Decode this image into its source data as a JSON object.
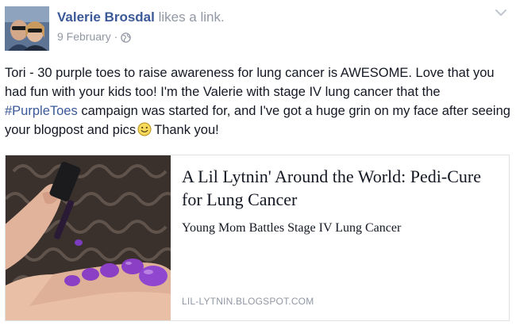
{
  "post": {
    "author": "Valerie Brosdal",
    "action": "likes a link.",
    "date": "9 February",
    "separator": "·",
    "privacy_icon": "globe-icon",
    "options_icon": "chevron-down-icon",
    "message": {
      "part1": "Tori - 30 purple toes to raise awareness for lung cancer is AWESOME. Love that you had fun with your kids too! I'm the Valerie with stage IV lung cancer that the ",
      "hashtag": "#PurpleToes",
      "part2": " campaign was started for, and I've got a huge grin on my face after seeing your blogpost and pics",
      "emoji_icon": "smile-emoji-icon",
      "part3": "Thank you!"
    }
  },
  "link_card": {
    "title": "A Lil Lytnin' Around the World: Pedi-Cure for Lung Cancer",
    "subtitle": "Young Mom Battles Stage IV Lung Cancer",
    "domain": "LIL-LYTNIN.BLOGSPOT.COM",
    "thumbnail_icon": "painted-toenails-photo"
  },
  "colors": {
    "link_blue": "#3b5998",
    "meta_gray": "#9197a3",
    "text": "#141823",
    "nail_polish": "#8a3fc4"
  }
}
